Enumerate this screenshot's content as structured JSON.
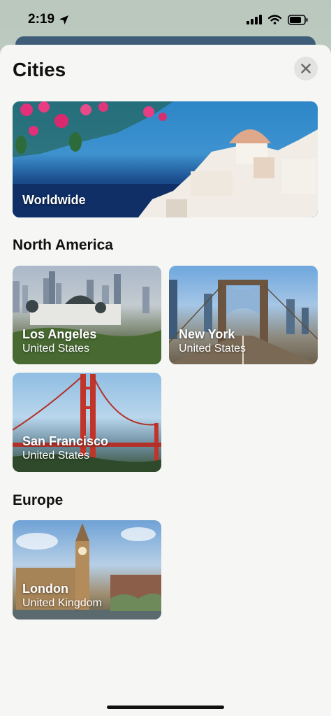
{
  "status": {
    "time": "2:19"
  },
  "sheet": {
    "title": "Cities",
    "close_label": "✕"
  },
  "featured": {
    "label": "Worldwide"
  },
  "sections": [
    {
      "title": "North America",
      "cities": [
        {
          "name": "Los Angeles",
          "country": "United States"
        },
        {
          "name": "New York",
          "country": "United States"
        },
        {
          "name": "San Francisco",
          "country": "United States"
        }
      ]
    },
    {
      "title": "Europe",
      "cities": [
        {
          "name": "London",
          "country": "United Kingdom"
        }
      ]
    }
  ]
}
